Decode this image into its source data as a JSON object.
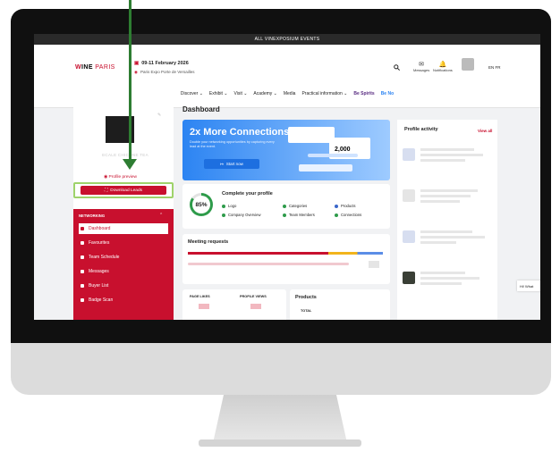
{
  "topbar": {
    "label": "ALL VINEXPOSIUM EVENTS"
  },
  "header": {
    "logo_prefix": "W",
    "logo_mid": "INE",
    "logo_suffix": "PARIS",
    "dates": "09-11 February 2026",
    "venue": "Paris Expo Porte de Versailles",
    "messages_label": "Messages",
    "notifications_label": "Notifications",
    "lang": "EN  FR"
  },
  "nav": {
    "items": [
      "Discover ⌄",
      "Exhibit ⌄",
      "Visit ⌄",
      "Academy ⌄",
      "Media",
      "Practical information ⌄"
    ],
    "brand1": "Be Spirits",
    "brand2": "Be No"
  },
  "sidebar": {
    "profile_name": "ECALE CHICONE TEA",
    "profile_preview": "Profile preview",
    "download_leads": "Download Leads",
    "menu_header": "NETWORKING",
    "menu_items": [
      "Dashboard",
      "Favourites",
      "Team Schedule",
      "Messages",
      "Buyer List",
      "Badge Scan"
    ]
  },
  "main": {
    "title": "Dashboard",
    "banner_title": "2x More Connections",
    "banner_sub": "Double your networking opportunities by capturing every lead at the event.",
    "start_now": "Start now",
    "banner_card_value": "2,000",
    "complete_profile": "Complete your profile",
    "progress_percent": "85%",
    "checklist": [
      "Logo",
      "Categories",
      "Products",
      "Company Overview",
      "Team Members",
      "Connections"
    ],
    "meeting_requests": "Meeting requests",
    "page_likes": "PAGE LIKES",
    "profile_views": "PROFILE VIEWS",
    "products": "Products",
    "total": "TOTAL"
  },
  "activity": {
    "title": "Profile activity",
    "view_all": "View all"
  },
  "chat": {
    "label": "Hi! What"
  },
  "colors": {
    "brand_red": "#c8102e",
    "banner_blue": "#2c84f2",
    "highlight_green": "#9fd36b",
    "arrow_green": "#2e7d32"
  }
}
